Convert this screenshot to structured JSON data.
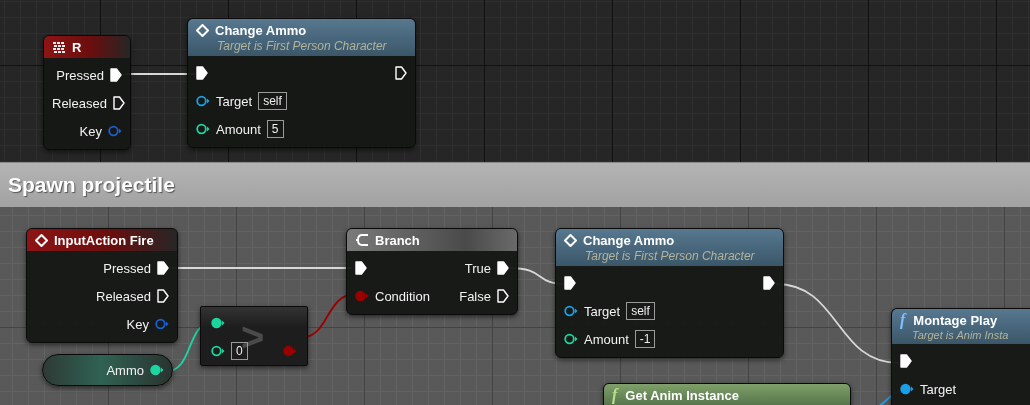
{
  "graph_top": {
    "nodes": [
      {
        "kind": "key_event",
        "title": "R",
        "rows": [
          {
            "right": {
              "kind": "exec",
              "label": "Pressed",
              "connected": true
            }
          },
          {
            "right": {
              "kind": "exec",
              "label": "Released",
              "connected": false
            }
          },
          {
            "right": {
              "kind": "data",
              "label": "Key",
              "connected": false,
              "color": "#1a5fd0"
            }
          }
        ]
      },
      {
        "kind": "event_call",
        "title": "Change Ammo",
        "subtitle": "Target is First Person Character",
        "rows": [
          {
            "left": {
              "kind": "exec",
              "connected": true
            },
            "right": {
              "kind": "exec",
              "connected": false
            }
          },
          {
            "left": {
              "kind": "data",
              "label": "Target",
              "connected": false,
              "color": "#1aa0e8",
              "value": "self"
            }
          },
          {
            "left": {
              "kind": "data",
              "label": "Amount",
              "connected": false,
              "color": "#1cd6a0",
              "value": "5"
            }
          }
        ]
      }
    ]
  },
  "comment": {
    "title": "Spawn projectile",
    "nodes": [
      {
        "kind": "event",
        "title": "InputAction Fire",
        "rows": [
          {
            "right": {
              "kind": "exec",
              "label": "Pressed",
              "connected": true
            }
          },
          {
            "right": {
              "kind": "exec",
              "label": "Released",
              "connected": false
            }
          },
          {
            "right": {
              "kind": "data",
              "label": "Key",
              "connected": false,
              "color": "#1a5fd0"
            }
          }
        ]
      },
      {
        "kind": "operator",
        "operator": ">",
        "rows": [
          {
            "left": {
              "kind": "data",
              "connected": true,
              "color": "#1cd6a0"
            }
          },
          {
            "left": {
              "kind": "data",
              "connected": false,
              "color": "#1cd6a0",
              "value": "0"
            },
            "right": {
              "kind": "data",
              "connected": true,
              "color": "#9a0000"
            }
          }
        ]
      },
      {
        "kind": "variable",
        "rows": [
          {
            "right": {
              "kind": "data",
              "label": "Ammo",
              "connected": true,
              "color": "#1cd6a0"
            }
          }
        ]
      },
      {
        "kind": "branch",
        "title": "Branch",
        "rows": [
          {
            "left": {
              "kind": "exec",
              "connected": true
            },
            "right": {
              "kind": "exec",
              "label": "True",
              "connected": true
            }
          },
          {
            "left": {
              "kind": "data",
              "label": "Condition",
              "connected": true,
              "color": "#9a0000"
            },
            "right": {
              "kind": "exec",
              "label": "False",
              "connected": false
            }
          }
        ]
      },
      {
        "kind": "event_call",
        "title": "Change Ammo",
        "subtitle": "Target is First Person Character",
        "rows": [
          {
            "left": {
              "kind": "exec",
              "connected": true
            },
            "right": {
              "kind": "exec",
              "connected": true
            }
          },
          {
            "left": {
              "kind": "data",
              "label": "Target",
              "connected": false,
              "color": "#1aa0e8",
              "value": "self"
            }
          },
          {
            "left": {
              "kind": "data",
              "label": "Amount",
              "connected": false,
              "color": "#1cd6a0",
              "value": "-1"
            }
          }
        ]
      },
      {
        "kind": "function",
        "glyph": "f",
        "title": "Montage Play",
        "subtitle": "Target is Anim Insta",
        "rows": [
          {
            "left": {
              "kind": "exec",
              "connected": true
            }
          },
          {
            "left": {
              "kind": "data",
              "label": "Target",
              "connected": true,
              "color": "#1aa0e8"
            }
          }
        ]
      },
      {
        "kind": "pure_function",
        "glyph": "f",
        "title": "Get Anim Instance"
      }
    ]
  }
}
